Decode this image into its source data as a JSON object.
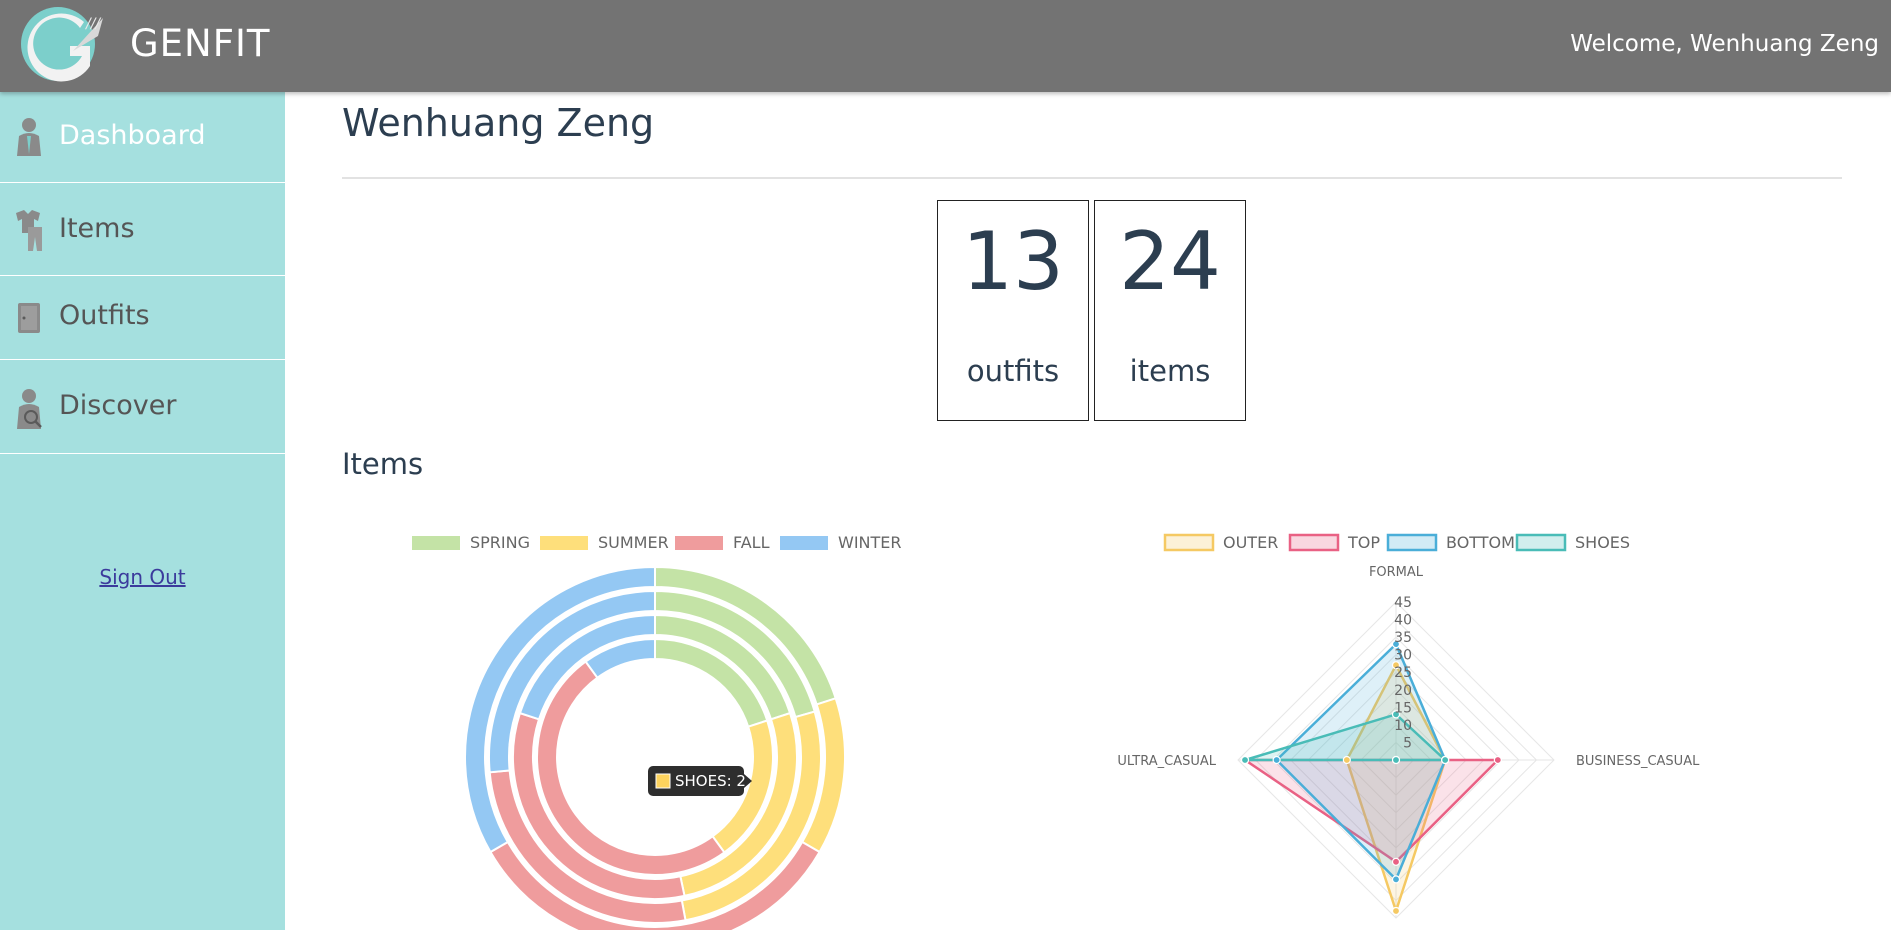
{
  "header": {
    "brand": "GENFIT",
    "welcome": "Welcome, Wenhuang Zeng"
  },
  "sidebar": {
    "items": [
      {
        "label": "Dashboard",
        "icon": "person-icon",
        "active": true
      },
      {
        "label": "Items",
        "icon": "clothes-icon",
        "active": false
      },
      {
        "label": "Outfits",
        "icon": "wardrobe-icon",
        "active": false
      },
      {
        "label": "Discover",
        "icon": "search-person-icon",
        "active": false
      }
    ],
    "sign_out": "Sign Out"
  },
  "main": {
    "title": "Wenhuang Zeng",
    "stats": [
      {
        "value": "13",
        "label": "outfits"
      },
      {
        "value": "24",
        "label": "items"
      }
    ],
    "section_title": "Items"
  },
  "chart_data": [
    {
      "type": "doughnut",
      "legend": [
        "SPRING",
        "SUMMER",
        "FALL",
        "WINTER"
      ],
      "legend_position": "top",
      "colors": {
        "SPRING": "#c4e3a6",
        "SUMMER": "#fedf7b",
        "FALL": "#ef9c9d",
        "WINTER": "#94c8f3"
      },
      "rings": [
        {
          "name": "OUTER",
          "values": {
            "SPRING": 3,
            "SUMMER": 2,
            "FALL": 5,
            "WINTER": 5
          }
        },
        {
          "name": "TOP",
          "values": {
            "SPRING": 7,
            "SUMMER": 9,
            "FALL": 9,
            "WINTER": 9
          }
        },
        {
          "name": "BOTTOM",
          "values": {
            "SPRING": 3,
            "SUMMER": 4,
            "FALL": 5,
            "WINTER": 3
          }
        },
        {
          "name": "SHOES",
          "values": {
            "SPRING": 2,
            "SUMMER": 2,
            "FALL": 5,
            "WINTER": 1
          }
        }
      ],
      "tooltip": {
        "label": "SHOES: 2",
        "color": "#fdd35e"
      }
    },
    {
      "type": "radar",
      "legend": [
        "OUTER",
        "TOP",
        "BOTTOM",
        "SHOES"
      ],
      "legend_position": "top",
      "axes": [
        "FORMAL",
        "BUSINESS_CASUAL",
        "",
        "ULTRA_CASUAL"
      ],
      "ticks": [
        5,
        10,
        15,
        20,
        25,
        30,
        35,
        40,
        45
      ],
      "r_max": 45,
      "series": [
        {
          "name": "OUTER",
          "color": "#f5c963",
          "values": [
            27,
            14,
            43,
            14
          ]
        },
        {
          "name": "TOP",
          "color": "#e96184",
          "values": [
            0,
            29,
            29,
            43
          ]
        },
        {
          "name": "BOTTOM",
          "color": "#4aaed8",
          "values": [
            33,
            14,
            34,
            34
          ]
        },
        {
          "name": "SHOES",
          "color": "#49bcb7",
          "values": [
            13,
            14,
            0,
            43
          ]
        }
      ]
    }
  ]
}
